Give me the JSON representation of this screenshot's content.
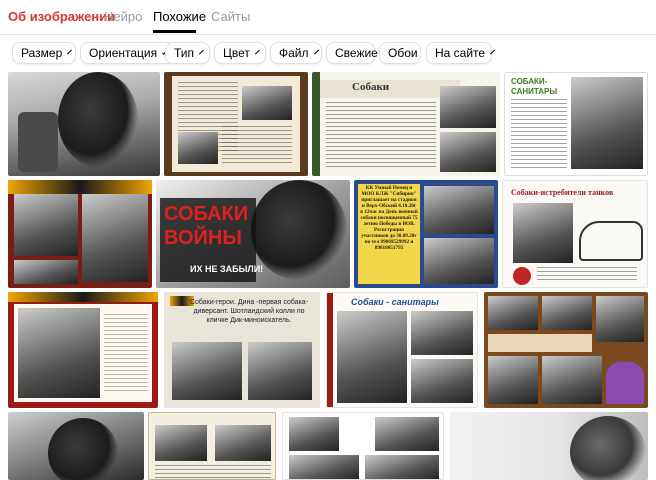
{
  "tabs": [
    {
      "label": "Об изображении"
    },
    {
      "label": "Нейро"
    },
    {
      "label": "Похожие"
    },
    {
      "label": "Сайты"
    }
  ],
  "filters": [
    {
      "label": "Размер"
    },
    {
      "label": "Ориентация"
    },
    {
      "label": "Тип"
    },
    {
      "label": "Цвет"
    },
    {
      "label": "Файл"
    },
    {
      "label": "Свежие"
    },
    {
      "label": "Обои"
    },
    {
      "label": "На сайте"
    }
  ],
  "results": {
    "r1c2_title": "Собаки",
    "r1c3_title": "Собаки-санитары",
    "r1c3_title_l1": "СОБАКИ-",
    "r1c3_title_l2": "САНИТАРЫ",
    "r2c2_line1": "СОБАКИ",
    "r2c2_line2": "ВОЙНЫ",
    "r2c2_line3": "ИХ НЕ ЗАБЫЛИ!",
    "r2c3_text": "КК Умный Немец и МОО КЛЖ \"Сибирия\" приглашает на стадион и Верх-Обский 4.10.20г в 12час на День военной собаки посвященный 75 летию Победы в ВОВ. Регистрация участников до 30.09.20г по тел 89069529992 и 89618051793",
    "r2c4_title": "Собаки-истребители танков",
    "r3c2_text": "Собаки-герои. Дина -первая собака-диверсант. Шотландский колли по кличке Дик-миноискатель.",
    "r3c3_title": "Собаки - санитары"
  },
  "colors": {
    "brand_red": "#d7362b",
    "active_tab": "#000000",
    "inactive_tab": "#9a9a9a",
    "victory_red": "#c0261f",
    "poster_blue": "#2b4a8b"
  }
}
